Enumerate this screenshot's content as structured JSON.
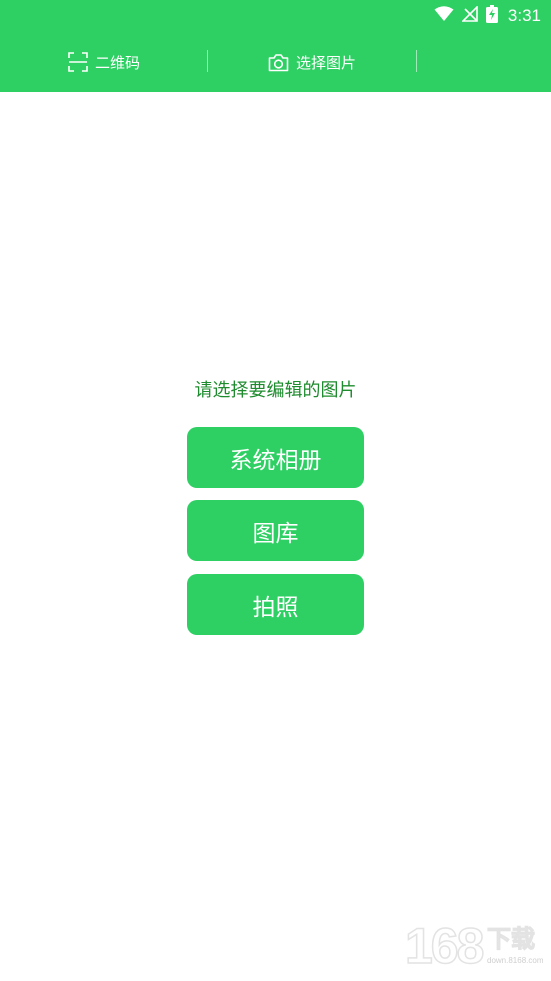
{
  "status_bar": {
    "time": "3:31",
    "icons": [
      "wifi-icon",
      "no-signal-icon",
      "battery-charging-icon"
    ]
  },
  "top_bar": {
    "tabs": [
      {
        "label": "二维码",
        "icon": "qr-scan-icon"
      },
      {
        "label": "选择图片",
        "icon": "camera-icon"
      }
    ]
  },
  "main": {
    "prompt": "请选择要编辑的图片",
    "buttons": [
      {
        "label": "系统相册"
      },
      {
        "label": "图库"
      },
      {
        "label": "拍照"
      }
    ]
  },
  "watermark": {
    "number": "168",
    "text": "下载",
    "url": "down.8168.com"
  },
  "colors": {
    "accent": "#2ecf63",
    "prompt_text": "#1e8c2e",
    "background": "#ffffff"
  }
}
